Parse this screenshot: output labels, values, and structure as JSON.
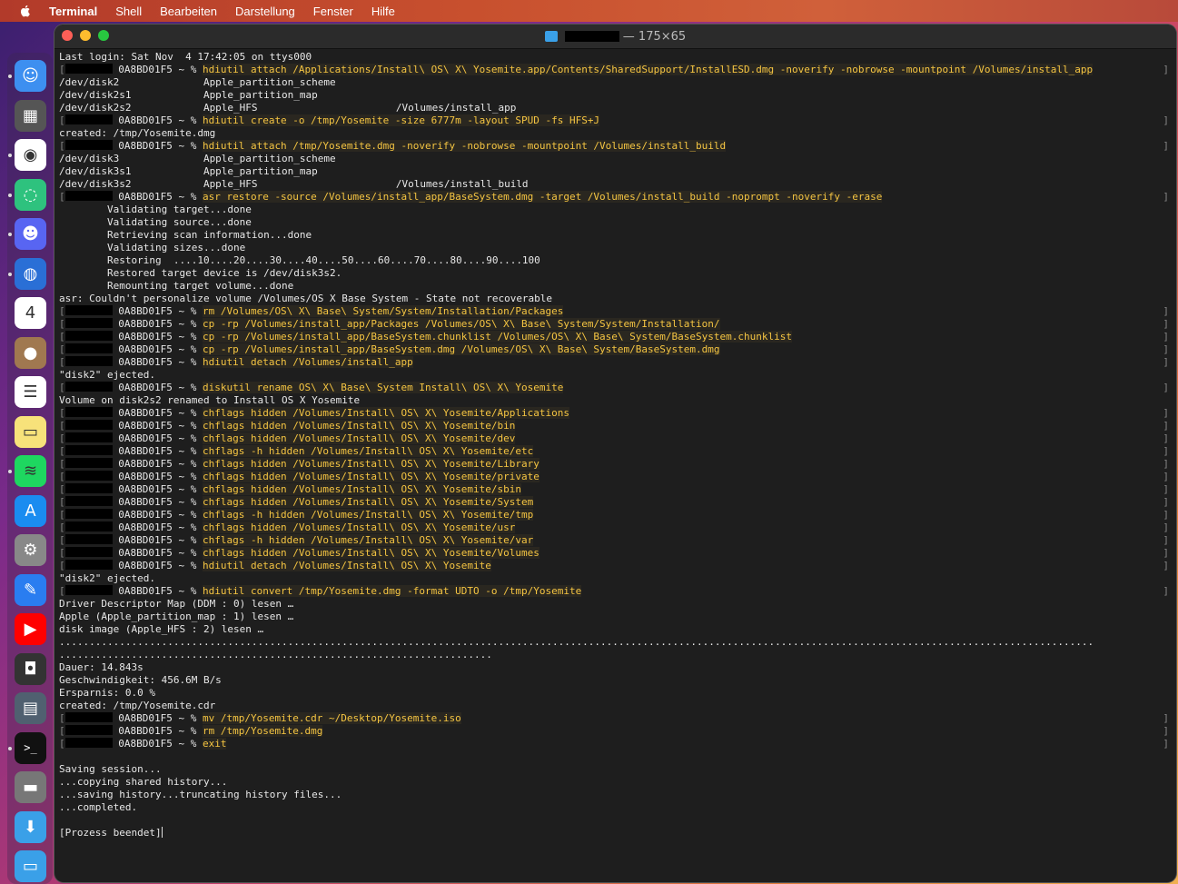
{
  "menubar": {
    "app": "Terminal",
    "items": [
      "Shell",
      "Bearbeiten",
      "Darstellung",
      "Fenster",
      "Hilfe"
    ]
  },
  "window": {
    "title_suffix": "— 175×65"
  },
  "prompt": {
    "host": "0A8BD01F5 ~ %"
  },
  "dock": {
    "icons": [
      {
        "name": "finder-icon",
        "glyph": "☺",
        "bg": "#3d8ff0"
      },
      {
        "name": "launchpad-icon",
        "glyph": "▦",
        "bg": "#555"
      },
      {
        "name": "chrome-icon",
        "glyph": "◉",
        "bg": "#fff"
      },
      {
        "name": "messenger-icon",
        "glyph": "◌",
        "bg": "#2ec27e"
      },
      {
        "name": "discord-icon",
        "glyph": "☻",
        "bg": "#5865f2"
      },
      {
        "name": "thunderbird-icon",
        "glyph": "◍",
        "bg": "#2a6fd6"
      },
      {
        "name": "calendar-icon",
        "glyph": "4",
        "bg": "#fff"
      },
      {
        "name": "contacts-icon",
        "glyph": "●",
        "bg": "#a07850"
      },
      {
        "name": "reminders-icon",
        "glyph": "☰",
        "bg": "#fff"
      },
      {
        "name": "notes-icon",
        "glyph": "▭",
        "bg": "#f7e27a"
      },
      {
        "name": "spotify-icon",
        "glyph": "≋",
        "bg": "#1ed760"
      },
      {
        "name": "app-store-icon",
        "glyph": "A",
        "bg": "#1a8cf0"
      },
      {
        "name": "system-settings-icon",
        "glyph": "⚙",
        "bg": "#888"
      },
      {
        "name": "xcode-icon",
        "glyph": "✎",
        "bg": "#2a7df0"
      },
      {
        "name": "youtube-icon",
        "glyph": "▶",
        "bg": "#ff0000"
      },
      {
        "name": "screenshot-icon",
        "glyph": "◘",
        "bg": "#333"
      },
      {
        "name": "image-thumbnail-icon",
        "glyph": "▤",
        "bg": "#506070"
      },
      {
        "name": "terminal-icon",
        "glyph": ">_",
        "bg": "#111"
      },
      {
        "name": "disk-icon",
        "glyph": "▬",
        "bg": "#777"
      },
      {
        "name": "downloads-folder-icon",
        "glyph": "⬇",
        "bg": "#3aa0e8"
      },
      {
        "name": "folder-icon",
        "glyph": "▭",
        "bg": "#3aa0e8"
      }
    ]
  },
  "lines": [
    {
      "t": "out",
      "text": "Last login: Sat Nov  4 17:42:05 on ttys000"
    },
    {
      "t": "cmd",
      "cmd": "hdiutil attach /Applications/Install\\ OS\\ X\\ Yosemite.app/Contents/SharedSupport/InstallESD.dmg -noverify -nobrowse -mountpoint /Volumes/install_app"
    },
    {
      "t": "out",
      "text": "/dev/disk2              Apple_partition_scheme"
    },
    {
      "t": "out",
      "text": "/dev/disk2s1            Apple_partition_map"
    },
    {
      "t": "out",
      "text": "/dev/disk2s2            Apple_HFS                       /Volumes/install_app"
    },
    {
      "t": "cmd",
      "cmd": "hdiutil create -o /tmp/Yosemite -size 6777m -layout SPUD -fs HFS+J"
    },
    {
      "t": "out",
      "text": "created: /tmp/Yosemite.dmg"
    },
    {
      "t": "cmd",
      "cmd": "hdiutil attach /tmp/Yosemite.dmg -noverify -nobrowse -mountpoint /Volumes/install_build"
    },
    {
      "t": "out",
      "text": "/dev/disk3              Apple_partition_scheme"
    },
    {
      "t": "out",
      "text": "/dev/disk3s1            Apple_partition_map"
    },
    {
      "t": "out",
      "text": "/dev/disk3s2            Apple_HFS                       /Volumes/install_build"
    },
    {
      "t": "cmd",
      "cmd": "asr restore -source /Volumes/install_app/BaseSystem.dmg -target /Volumes/install_build -noprompt -noverify -erase"
    },
    {
      "t": "out",
      "text": "        Validating target...done"
    },
    {
      "t": "out",
      "text": "        Validating source...done"
    },
    {
      "t": "out",
      "text": "        Retrieving scan information...done"
    },
    {
      "t": "out",
      "text": "        Validating sizes...done"
    },
    {
      "t": "out",
      "text": "        Restoring  ....10....20....30....40....50....60....70....80....90....100"
    },
    {
      "t": "out",
      "text": "        Restored target device is /dev/disk3s2."
    },
    {
      "t": "out",
      "text": "        Remounting target volume...done"
    },
    {
      "t": "out",
      "text": "asr: Couldn't personalize volume /Volumes/OS X Base System - State not recoverable"
    },
    {
      "t": "cmd",
      "cmd": "rm /Volumes/OS\\ X\\ Base\\ System/System/Installation/Packages"
    },
    {
      "t": "cmd",
      "cmd": "cp -rp /Volumes/install_app/Packages /Volumes/OS\\ X\\ Base\\ System/System/Installation/"
    },
    {
      "t": "cmd",
      "cmd": "cp -rp /Volumes/install_app/BaseSystem.chunklist /Volumes/OS\\ X\\ Base\\ System/BaseSystem.chunklist"
    },
    {
      "t": "cmd",
      "cmd": "cp -rp /Volumes/install_app/BaseSystem.dmg /Volumes/OS\\ X\\ Base\\ System/BaseSystem.dmg"
    },
    {
      "t": "cmd",
      "cmd": "hdiutil detach /Volumes/install_app"
    },
    {
      "t": "out",
      "text": "\"disk2\" ejected."
    },
    {
      "t": "cmd",
      "cmd": "diskutil rename OS\\ X\\ Base\\ System Install\\ OS\\ X\\ Yosemite"
    },
    {
      "t": "out",
      "text": "Volume on disk2s2 renamed to Install OS X Yosemite"
    },
    {
      "t": "cmd",
      "cmd": "chflags hidden /Volumes/Install\\ OS\\ X\\ Yosemite/Applications"
    },
    {
      "t": "cmd",
      "cmd": "chflags hidden /Volumes/Install\\ OS\\ X\\ Yosemite/bin"
    },
    {
      "t": "cmd",
      "cmd": "chflags hidden /Volumes/Install\\ OS\\ X\\ Yosemite/dev"
    },
    {
      "t": "cmd",
      "cmd": "chflags -h hidden /Volumes/Install\\ OS\\ X\\ Yosemite/etc"
    },
    {
      "t": "cmd",
      "cmd": "chflags hidden /Volumes/Install\\ OS\\ X\\ Yosemite/Library"
    },
    {
      "t": "cmd",
      "cmd": "chflags hidden /Volumes/Install\\ OS\\ X\\ Yosemite/private"
    },
    {
      "t": "cmd",
      "cmd": "chflags hidden /Volumes/Install\\ OS\\ X\\ Yosemite/sbin"
    },
    {
      "t": "cmd",
      "cmd": "chflags hidden /Volumes/Install\\ OS\\ X\\ Yosemite/System"
    },
    {
      "t": "cmd",
      "cmd": "chflags -h hidden /Volumes/Install\\ OS\\ X\\ Yosemite/tmp"
    },
    {
      "t": "cmd",
      "cmd": "chflags hidden /Volumes/Install\\ OS\\ X\\ Yosemite/usr"
    },
    {
      "t": "cmd",
      "cmd": "chflags -h hidden /Volumes/Install\\ OS\\ X\\ Yosemite/var"
    },
    {
      "t": "cmd",
      "cmd": "chflags hidden /Volumes/Install\\ OS\\ X\\ Yosemite/Volumes"
    },
    {
      "t": "cmd",
      "cmd": "hdiutil detach /Volumes/Install\\ OS\\ X\\ Yosemite"
    },
    {
      "t": "out",
      "text": "\"disk2\" ejected."
    },
    {
      "t": "cmd",
      "cmd": "hdiutil convert /tmp/Yosemite.dmg -format UDTO -o /tmp/Yosemite"
    },
    {
      "t": "out",
      "text": "Driver Descriptor Map (DDM : 0) lesen …"
    },
    {
      "t": "out",
      "text": "Apple (Apple_partition_map : 1) lesen …"
    },
    {
      "t": "out",
      "text": "disk image (Apple_HFS : 2) lesen …"
    },
    {
      "t": "out",
      "text": "............................................................................................................................................................................"
    },
    {
      "t": "out",
      "text": "........................................................................"
    },
    {
      "t": "out",
      "text": "Dauer: 14.843s"
    },
    {
      "t": "out",
      "text": "Geschwindigkeit: 456.6M B/s"
    },
    {
      "t": "out",
      "text": "Ersparnis: 0.0 %"
    },
    {
      "t": "out",
      "text": "created: /tmp/Yosemite.cdr"
    },
    {
      "t": "cmd",
      "cmd": "mv /tmp/Yosemite.cdr ~/Desktop/Yosemite.iso"
    },
    {
      "t": "cmd",
      "cmd": "rm /tmp/Yosemite.dmg"
    },
    {
      "t": "cmd",
      "cmd": "exit"
    },
    {
      "t": "out",
      "text": ""
    },
    {
      "t": "out",
      "text": "Saving session..."
    },
    {
      "t": "out",
      "text": "...copying shared history..."
    },
    {
      "t": "out",
      "text": "...saving history...truncating history files..."
    },
    {
      "t": "out",
      "text": "...completed."
    },
    {
      "t": "out",
      "text": ""
    },
    {
      "t": "end",
      "text": "[Prozess beendet]"
    }
  ]
}
